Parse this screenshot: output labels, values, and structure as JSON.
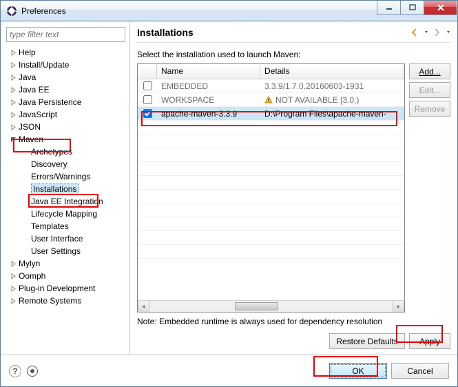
{
  "window": {
    "title": "Preferences"
  },
  "filter": {
    "placeholder": "type filter text"
  },
  "tree": {
    "items": [
      {
        "label": "Help",
        "expandable": true
      },
      {
        "label": "Install/Update",
        "expandable": true
      },
      {
        "label": "Java",
        "expandable": true
      },
      {
        "label": "Java EE",
        "expandable": true
      },
      {
        "label": "Java Persistence",
        "expandable": true
      },
      {
        "label": "JavaScript",
        "expandable": true
      },
      {
        "label": "JSON",
        "expandable": true
      },
      {
        "label": "Maven",
        "expandable": true,
        "expanded": true
      },
      {
        "label": "Archetypes",
        "child": true
      },
      {
        "label": "Discovery",
        "child": true
      },
      {
        "label": "Errors/Warnings",
        "child": true
      },
      {
        "label": "Installations",
        "child": true,
        "selected": true
      },
      {
        "label": "Java EE Integration",
        "child": true
      },
      {
        "label": "Lifecycle Mapping",
        "child": true
      },
      {
        "label": "Templates",
        "child": true
      },
      {
        "label": "User Interface",
        "child": true
      },
      {
        "label": "User Settings",
        "child": true
      },
      {
        "label": "Mylyn",
        "expandable": true
      },
      {
        "label": "Oomph",
        "expandable": true
      },
      {
        "label": "Plug-in Development",
        "expandable": true
      },
      {
        "label": "Remote Systems",
        "expandable": true
      }
    ]
  },
  "page": {
    "title": "Installations",
    "description": "Select the installation used to launch Maven:",
    "note": "Note: Embedded runtime is always used for dependency resolution",
    "columns": {
      "name": "Name",
      "details": "Details"
    },
    "rows": [
      {
        "checked": false,
        "name": "EMBEDDED",
        "details": "3.3.9/1.7.0.20160603-1931",
        "warn": false
      },
      {
        "checked": false,
        "name": "WORKSPACE",
        "details": "NOT AVAILABLE [3.0,)",
        "warn": true
      },
      {
        "checked": true,
        "name": "apache-maven-3.3.9",
        "details": "D:\\Program Files\\apache-maven-",
        "warn": false,
        "selected": true
      }
    ],
    "buttons": {
      "add": "Add...",
      "edit": "Edit...",
      "remove": "Remove",
      "restore": "Restore Defaults",
      "apply": "Apply"
    }
  },
  "footer": {
    "ok": "OK",
    "cancel": "Cancel"
  }
}
